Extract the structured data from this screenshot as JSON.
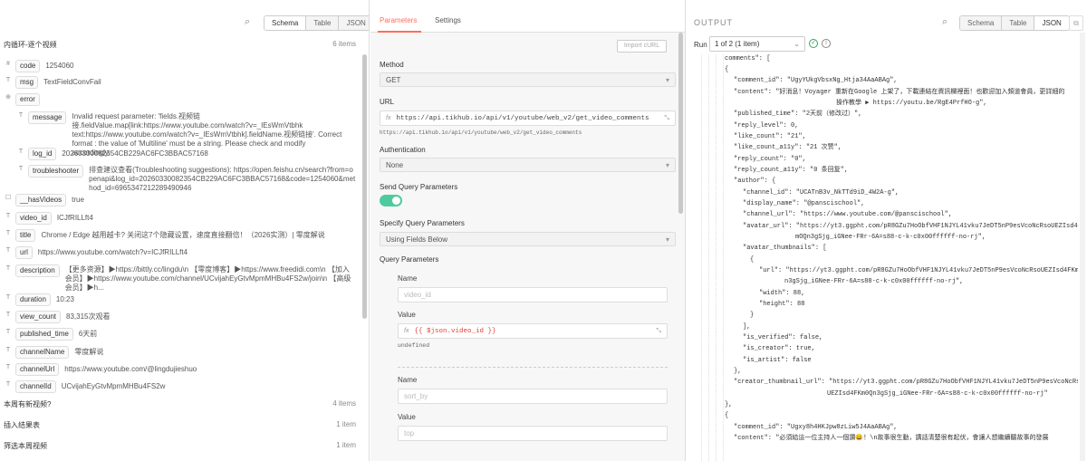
{
  "left": {
    "tabs": [
      "Schema",
      "Table",
      "JSON"
    ],
    "header": {
      "title": "内循环-逐个视频",
      "count": "6 items"
    },
    "fields": [
      {
        "icon": "#",
        "key": "code",
        "value": "1254060"
      },
      {
        "icon": "T",
        "key": "msg",
        "value": "TextFieldConvFail"
      },
      {
        "icon": "⊕",
        "key": "error",
        "value": ""
      },
      {
        "icon": "T",
        "key": "message",
        "value": "Invalid request parameter: 'fields.视频链接.fieldValue.map[link:https://www.youtube.com/watch?v=_IEsWmVtbhk text:https://www.youtube.com/watch?v=_IEsWmVtbhk].fieldName.视频链接'. Correct format : the value of 'Multiline' must be a string. Please check and modify accordingly."
      },
      {
        "icon": "T",
        "key": "log_id",
        "value": "20260330082354CB229AC6FC3BBAC57168"
      },
      {
        "icon": "T",
        "key": "troubleshooter",
        "value": "排查建议查看(Troubleshooting suggestions): https://open.feishu.cn/search?from=openapi&log_id=20260330082354CB229AC6FC3BBAC57168&code=1254060&method_id=6965347212289490946"
      },
      {
        "icon": "☐",
        "key": "__hasVideos",
        "value": "true"
      },
      {
        "icon": "T",
        "key": "video_id",
        "value": "ICJfRILLft4"
      },
      {
        "icon": "T",
        "key": "title",
        "value": "Chrome / Edge 越用越卡? 关闭这7个隐藏设置，速度直接翻倍！（2026实测）| 零度解说"
      },
      {
        "icon": "T",
        "key": "url",
        "value": "https://www.youtube.com/watch?v=ICJfRILLft4"
      },
      {
        "icon": "T",
        "key": "description",
        "value": "【更多资源】▶https://bittly.cc/lingdu\\n 【零度博客】▶https://www.freedidi.com\\n 【加入会员】▶https://www.youtube.com/channel/UCvijahEyGtvMpmMHBu4FS2w/join\\n 【高级会员】▶h..."
      },
      {
        "icon": "T",
        "key": "duration",
        "value": "10:23"
      },
      {
        "icon": "T",
        "key": "view_count",
        "value": "83,315次观看"
      },
      {
        "icon": "T",
        "key": "published_time",
        "value": "6天前"
      },
      {
        "icon": "T",
        "key": "channelName",
        "value": "零度解说"
      },
      {
        "icon": "T",
        "key": "channelUrl",
        "value": "https://www.youtube.com/@lingdujieshuo"
      },
      {
        "icon": "T",
        "key": "channelId",
        "value": "UCvijahEyGtvMpmMHBu4FS2w"
      }
    ],
    "groups": [
      {
        "title": "本周有新视频?",
        "count": "4 items"
      },
      {
        "title": "插入结果表",
        "count": "1 item"
      },
      {
        "title": "筛选本周视频",
        "count": "1 item"
      }
    ]
  },
  "mid": {
    "tabs": [
      "Parameters",
      "Settings"
    ],
    "import_label": "Import cURL",
    "method_label": "Method",
    "method_value": "GET",
    "url_label": "URL",
    "url_fx": "fx",
    "url_value": "https://api.tikhub.io/api/v1/youtube/web_v2/get_video_comments",
    "url_preview": "https://api.tikhub.io/api/v1/youtube/web_v2/get_video_comments",
    "auth_label": "Authentication",
    "auth_value": "None",
    "send_query_label": "Send Query Parameters",
    "specify_label": "Specify Query Parameters",
    "specify_value": "Using Fields Below",
    "qp_label": "Query Parameters",
    "params": [
      {
        "name_label": "Name",
        "name_placeholder": "video_id",
        "value_label": "Value",
        "value_fx": "fx",
        "value": "{{ $json.video_id }}",
        "value_preview": "undefined"
      },
      {
        "name_label": "Name",
        "name_placeholder": "sort_by",
        "value_label": "Value",
        "value_placeholder": "top"
      }
    ]
  },
  "right": {
    "title": "OUTPUT",
    "tabs": [
      "Schema",
      "Table",
      "JSON"
    ],
    "run_label": "Run",
    "run_value": "1 of 2 (1 item)",
    "json_lines": [
      "comments\": [",
      "{",
      "\"comment_id\": \"UgyYUkgVbsxNg_Htja34AaABAg\",",
      "\"content\": \"好消息！Voyager 重新在Google 上架了，下載連結在資訊欄裡面！也歡迎加入頻道會員，更詳細的",
      "操作教學 ▶ https://youtu.be/RgE4PrfHO-g\",",
      "\"published_time\": \"2天前（修改过）\",",
      "\"reply_level\": 0,",
      "\"like_count\": \"21\",",
      "\"like_count_a11y\": \"21 次赞\",",
      "\"reply_count\": \"0\",",
      "\"reply_count_a11y\": \"0 条回复\",",
      "\"author\": {",
      "\"channel_id\": \"UCATnB3v_NkTTd9iD_4W2A-g\",",
      "\"display_name\": \"@panscischool\",",
      "\"channel_url\": \"https://www.youtube.com/@panscischool\",",
      "\"avatar_url\": \"https://yt3.ggpht.com/pR8GZu7HoObfVHF1NJYL41vku7JeDT5nP9esVcoNcRsoUEZIsd4FKm",
      "mOQn3gSjg_iGNee-FRr-6A=s88-c-k-c0x00ffffff-no-rj\",",
      "\"avatar_thumbnails\": [",
      "{",
      "\"url\": \"https://yt3.ggpht.com/pR8GZu7HoObfVHF1NJYL41vku7JeDT5nP9esVcoNcRsoUEZIsd4FKm0Q",
      "n3gSjg_iGNee-FRr-6A=s88-c-k-c0x00ffffff-no-rj\",",
      "\"width\": 88,",
      "\"height\": 88",
      "}",
      "],",
      "\"is_verified\": false,",
      "\"is_creator\": true,",
      "\"is_artist\": false",
      "},",
      "\"creator_thumbnail_url\": \"https://yt3.ggpht.com/pR8GZu7HoObfVHF1NJYL41vku7JeDT5nP9esVcoNcRso",
      "UEZIsd4FKm0Qn3gSjg_iGNee-FRr-6A=s88-c-k-c0x00ffffff-no-rj\"",
      "},",
      "{",
      "\"comment_id\": \"Ugxy8h4HKJpw8zLiw5J4AaABAg\",",
      "\"content\": \"必須給這一位主持人一個讚😀！\\n故事很生動，講話清楚很有起伏，會讓人想繼續聽故事的發展"
    ]
  },
  "colors": {
    "accent": "#ff6d5a",
    "toggle": "#4ecb9d",
    "tab_active": "#ff6d5a"
  }
}
